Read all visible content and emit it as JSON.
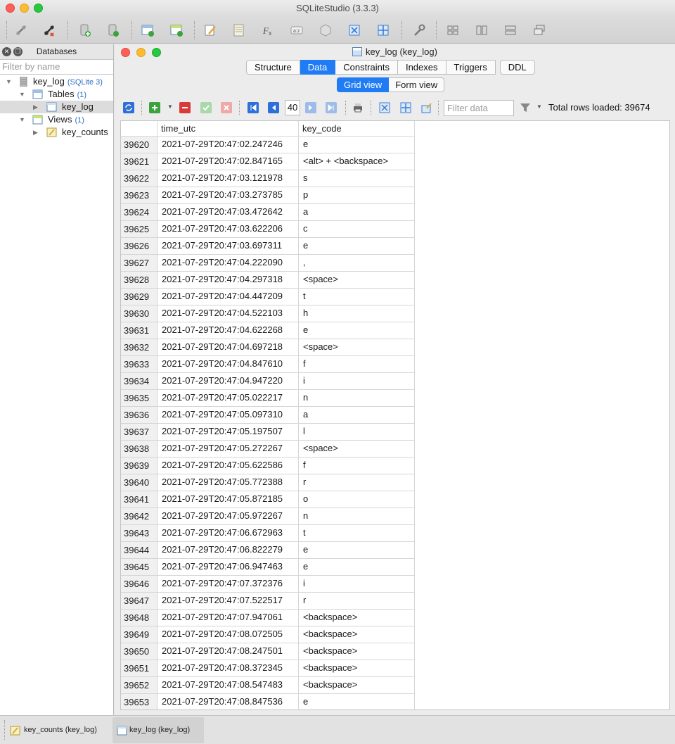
{
  "app": {
    "title": "SQLiteStudio (3.3.3)"
  },
  "databases_panel": {
    "title": "Databases",
    "filter_placeholder": "Filter by name",
    "tree": {
      "db_name": "key_log",
      "db_type": "(SQLite 3)",
      "tables_label": "Tables",
      "tables_count": "(1)",
      "table_item": "key_log",
      "views_label": "Views",
      "views_count": "(1)",
      "view_item": "key_counts"
    }
  },
  "editor": {
    "title": "key_log (key_log)",
    "tabs": [
      "Structure",
      "Data",
      "Constraints",
      "Indexes",
      "Triggers",
      "DDL"
    ],
    "active_tab": "Data",
    "subtabs": [
      "Grid view",
      "Form view"
    ],
    "active_subtab": "Grid view",
    "page_number": "40",
    "filter_placeholder": "Filter data",
    "total_rows": "Total rows loaded: 39674"
  },
  "grid": {
    "columns": [
      "time_utc",
      "key_code"
    ],
    "rows": [
      [
        "39620",
        "2021-07-29T20:47:02.247246",
        "e"
      ],
      [
        "39621",
        "2021-07-29T20:47:02.847165",
        "<alt> + <backspace>"
      ],
      [
        "39622",
        "2021-07-29T20:47:03.121978",
        "s"
      ],
      [
        "39623",
        "2021-07-29T20:47:03.273785",
        "p"
      ],
      [
        "39624",
        "2021-07-29T20:47:03.472642",
        "a"
      ],
      [
        "39625",
        "2021-07-29T20:47:03.622206",
        "c"
      ],
      [
        "39626",
        "2021-07-29T20:47:03.697311",
        "e"
      ],
      [
        "39627",
        "2021-07-29T20:47:04.222090",
        ","
      ],
      [
        "39628",
        "2021-07-29T20:47:04.297318",
        "<space>"
      ],
      [
        "39629",
        "2021-07-29T20:47:04.447209",
        "t"
      ],
      [
        "39630",
        "2021-07-29T20:47:04.522103",
        "h"
      ],
      [
        "39631",
        "2021-07-29T20:47:04.622268",
        "e"
      ],
      [
        "39632",
        "2021-07-29T20:47:04.697218",
        "<space>"
      ],
      [
        "39633",
        "2021-07-29T20:47:04.847610",
        "f"
      ],
      [
        "39634",
        "2021-07-29T20:47:04.947220",
        "i"
      ],
      [
        "39635",
        "2021-07-29T20:47:05.022217",
        "n"
      ],
      [
        "39636",
        "2021-07-29T20:47:05.097310",
        "a"
      ],
      [
        "39637",
        "2021-07-29T20:47:05.197507",
        "l"
      ],
      [
        "39638",
        "2021-07-29T20:47:05.272267",
        "<space>"
      ],
      [
        "39639",
        "2021-07-29T20:47:05.622586",
        "f"
      ],
      [
        "39640",
        "2021-07-29T20:47:05.772388",
        "r"
      ],
      [
        "39641",
        "2021-07-29T20:47:05.872185",
        "o"
      ],
      [
        "39642",
        "2021-07-29T20:47:05.972267",
        "n"
      ],
      [
        "39643",
        "2021-07-29T20:47:06.672963",
        "t"
      ],
      [
        "39644",
        "2021-07-29T20:47:06.822279",
        "e"
      ],
      [
        "39645",
        "2021-07-29T20:47:06.947463",
        "e"
      ],
      [
        "39646",
        "2021-07-29T20:47:07.372376",
        "i"
      ],
      [
        "39647",
        "2021-07-29T20:47:07.522517",
        "r"
      ],
      [
        "39648",
        "2021-07-29T20:47:07.947061",
        "<backspace>"
      ],
      [
        "39649",
        "2021-07-29T20:47:08.072505",
        "<backspace>"
      ],
      [
        "39650",
        "2021-07-29T20:47:08.247501",
        "<backspace>"
      ],
      [
        "39651",
        "2021-07-29T20:47:08.372345",
        "<backspace>"
      ],
      [
        "39652",
        "2021-07-29T20:47:08.547483",
        "<backspace>"
      ],
      [
        "39653",
        "2021-07-29T20:47:08.847536",
        "e"
      ]
    ]
  },
  "taskbar": {
    "items": [
      "key_counts (key_log)",
      "key_log (key_log)"
    ],
    "active": "key_log (key_log)"
  },
  "colors": {
    "accent": "#1f7cf4",
    "count_blue": "#2f6fc6",
    "close_red": "#fe5f57",
    "minimize_yellow": "#febc2e",
    "zoom_green": "#28c840"
  }
}
